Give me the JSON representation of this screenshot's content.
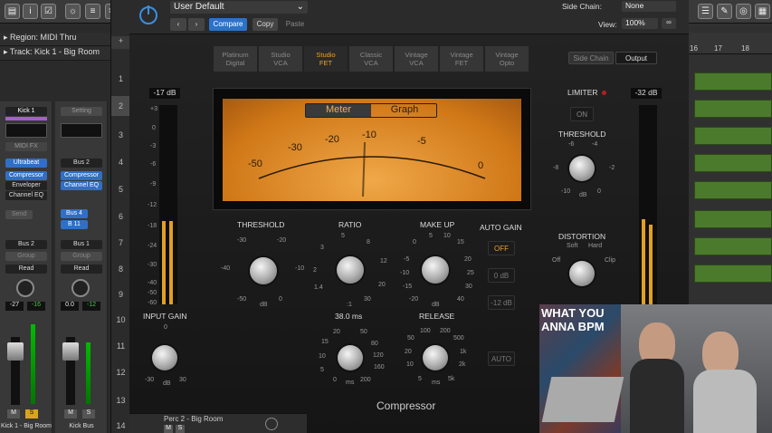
{
  "inspector": {
    "region": "Region: MIDI Thru",
    "track": "Track: Kick 1 - Big Room"
  },
  "toolbar_icons": [
    "library-icon",
    "info-icon",
    "inspector-icon",
    "eq-icon",
    "scissors-icon"
  ],
  "strip1": {
    "name": "Kick 1",
    "midi_fx": "MIDI FX",
    "instrument": "Ultrabeat",
    "inserts": [
      "Compressor",
      "Enveloper",
      "Channel EQ"
    ],
    "send": "Send",
    "output": "Bus 2",
    "group": "Group",
    "automation": "Read",
    "pan": "-27",
    "level": "-16",
    "m": "M",
    "s": "S",
    "footer": "Kick 1 - Big Room"
  },
  "strip2": {
    "name": "Setting",
    "instrument": "Bus 2",
    "inserts": [
      "Compressor",
      "Channel EQ"
    ],
    "sends": [
      "Bus 4",
      "B 11"
    ],
    "output": "Bus 1",
    "group": "Group",
    "automation": "Read",
    "pan": "0.0",
    "level": "-12",
    "m": "M",
    "s": "S",
    "footer": "Kick Bus"
  },
  "track_numbers": [
    "1",
    "2",
    "3",
    "4",
    "5",
    "6",
    "7",
    "8",
    "9",
    "10",
    "11",
    "12",
    "13",
    "14"
  ],
  "plugin": {
    "preset": "User Default",
    "compare": "Compare",
    "copy": "Copy",
    "paste": "Paste",
    "side_chain_label": "Side Chain:",
    "side_chain": "None",
    "view_label": "View:",
    "view": "100%",
    "models": [
      [
        "Platinum",
        "Digital"
      ],
      [
        "Studio",
        "VCA"
      ],
      [
        "Studio",
        "FET"
      ],
      [
        "Classic",
        "VCA"
      ],
      [
        "Vintage",
        "VCA"
      ],
      [
        "Vintage",
        "FET"
      ],
      [
        "Vintage",
        "Opto"
      ]
    ],
    "side_chain_btn": "Side Chain",
    "output_btn": "Output",
    "in_db": "-17 dB",
    "out_db": "-32 dB",
    "meter_tabs": [
      "Meter",
      "Graph"
    ],
    "meter_scale": [
      "-50",
      "-30",
      "-20",
      "-10",
      "-5",
      "0"
    ],
    "threshold": "THRESHOLD",
    "ratio": "RATIO",
    "makeup": "MAKE UP",
    "auto_gain": "AUTO GAIN",
    "auto_gain_opts": [
      "OFF",
      "0 dB",
      "-12 dB"
    ],
    "input_gain": "INPUT GAIN",
    "attack_val": "38.0 ms",
    "release": "RELEASE",
    "auto": "AUTO",
    "limiter": "LIMITER",
    "limiter_on": "ON",
    "lim_threshold": "THRESHOLD",
    "distortion": "DISTORTION",
    "dist_opts": [
      "Soft",
      "Hard",
      "Off",
      "Clip"
    ],
    "name": "Compressor",
    "left_meter_scale": [
      "+3",
      "0",
      "-3",
      "-6",
      "-9",
      "-12",
      "-18",
      "-24",
      "-30",
      "-40",
      "-50",
      "-60"
    ],
    "thr_scale": [
      "-30",
      "-20",
      "-40",
      "-10",
      "-50",
      "0",
      "dB"
    ],
    "ratio_scale": [
      "5",
      "8",
      "3",
      "12",
      "2",
      "20",
      "1.4",
      "30",
      ":1"
    ],
    "makeup_scale": [
      "5",
      "10",
      "0",
      "15",
      "-5",
      "20",
      "-10",
      "25",
      "-15",
      "30",
      "-20",
      "40",
      "dB"
    ],
    "gain_scale": [
      "0",
      "-30",
      "30",
      "dB"
    ],
    "attack_scale": [
      "20",
      "50",
      "15",
      "80",
      "10",
      "120",
      "5",
      "160",
      "0",
      "ms",
      "200"
    ],
    "release_scale": [
      "100",
      "200",
      "50",
      "500",
      "20",
      "1k",
      "10",
      "2k",
      "5",
      "ms",
      "5k"
    ],
    "lim_scale": [
      "-6",
      "-4",
      "-8",
      "-2",
      "-10",
      "0",
      "dB"
    ]
  },
  "right": {
    "ruler": [
      "16",
      "17",
      "18"
    ]
  },
  "video": {
    "sign": "WHAT YOU",
    "sign2": "ANNA BPM"
  },
  "bottom": {
    "track": "Perc 2 - Big Room",
    "m": "M",
    "s": "S"
  }
}
